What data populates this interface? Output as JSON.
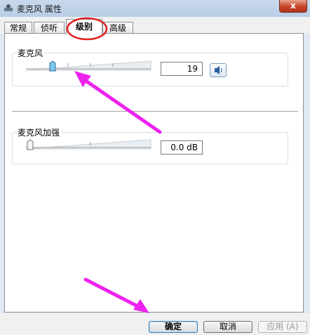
{
  "window": {
    "title": "麦克风 属性",
    "close_label": "x"
  },
  "tabs": [
    {
      "label": "常规",
      "active": false
    },
    {
      "label": "侦听",
      "active": false
    },
    {
      "label": "级别",
      "active": true
    },
    {
      "label": "高级",
      "active": false
    }
  ],
  "microphone": {
    "label": "麦克风",
    "value": "19",
    "level_percent": 19
  },
  "boost": {
    "label": "麦克风加强",
    "value": "0.0 dB",
    "level_percent": 0
  },
  "buttons": {
    "ok": "确定",
    "cancel": "取消",
    "apply": "应用 (A)"
  },
  "colors": {
    "annotation": "#ee22ee",
    "accent_button": "#3c7fb1"
  }
}
